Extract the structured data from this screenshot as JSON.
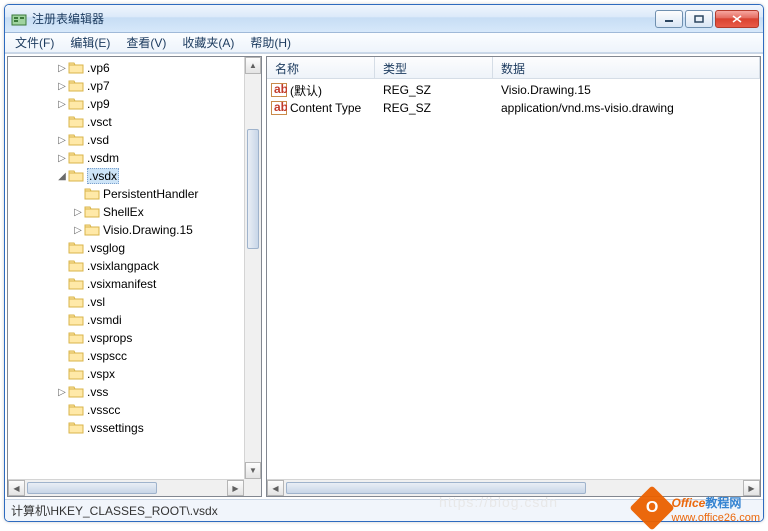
{
  "window": {
    "title": "注册表编辑器"
  },
  "menu": {
    "file": "文件(F)",
    "edit": "编辑(E)",
    "view": "查看(V)",
    "favorites": "收藏夹(A)",
    "help": "帮助(H)"
  },
  "tree": {
    "items": [
      {
        "indent": 3,
        "expander": "▷",
        "label": ".vp6"
      },
      {
        "indent": 3,
        "expander": "▷",
        "label": ".vp7"
      },
      {
        "indent": 3,
        "expander": "▷",
        "label": ".vp9"
      },
      {
        "indent": 3,
        "expander": "",
        "label": ".vsct"
      },
      {
        "indent": 3,
        "expander": "▷",
        "label": ".vsd"
      },
      {
        "indent": 3,
        "expander": "▷",
        "label": ".vsdm"
      },
      {
        "indent": 3,
        "expander": "◢",
        "label": ".vsdx",
        "selected": true
      },
      {
        "indent": 4,
        "expander": "",
        "label": "PersistentHandler"
      },
      {
        "indent": 4,
        "expander": "▷",
        "label": "ShellEx"
      },
      {
        "indent": 4,
        "expander": "▷",
        "label": "Visio.Drawing.15"
      },
      {
        "indent": 3,
        "expander": "",
        "label": ".vsglog"
      },
      {
        "indent": 3,
        "expander": "",
        "label": ".vsixlangpack"
      },
      {
        "indent": 3,
        "expander": "",
        "label": ".vsixmanifest"
      },
      {
        "indent": 3,
        "expander": "",
        "label": ".vsl"
      },
      {
        "indent": 3,
        "expander": "",
        "label": ".vsmdi"
      },
      {
        "indent": 3,
        "expander": "",
        "label": ".vsprops"
      },
      {
        "indent": 3,
        "expander": "",
        "label": ".vspscc"
      },
      {
        "indent": 3,
        "expander": "",
        "label": ".vspx"
      },
      {
        "indent": 3,
        "expander": "▷",
        "label": ".vss"
      },
      {
        "indent": 3,
        "expander": "",
        "label": ".vsscc"
      },
      {
        "indent": 3,
        "expander": "",
        "label": ".vssettings"
      }
    ]
  },
  "list": {
    "columns": {
      "name": "名称",
      "type": "类型",
      "data": "数据"
    },
    "rows": [
      {
        "name": "(默认)",
        "type": "REG_SZ",
        "data": "Visio.Drawing.15"
      },
      {
        "name": "Content Type",
        "type": "REG_SZ",
        "data": "application/vnd.ms-visio.drawing"
      }
    ]
  },
  "statusbar": {
    "path": "计算机\\HKEY_CLASSES_ROOT\\.vsdx"
  },
  "watermark": {
    "badge_letter": "O",
    "line1_a": "Office",
    "line1_b": "教程网",
    "line2": "www.office26.com",
    "ghost": "https://blog.csdn"
  }
}
